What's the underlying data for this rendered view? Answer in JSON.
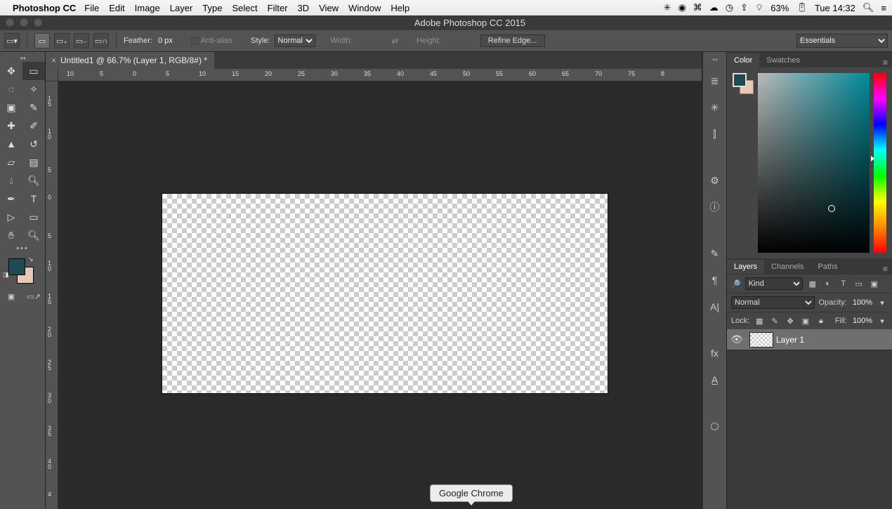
{
  "mac": {
    "app_name": "Photoshop CC",
    "menus": [
      "File",
      "Edit",
      "Image",
      "Layer",
      "Type",
      "Select",
      "Filter",
      "3D",
      "View",
      "Window",
      "Help"
    ],
    "battery_pct": "63%",
    "clock": "Tue 14:32"
  },
  "window": {
    "title": "Adobe Photoshop CC 2015"
  },
  "options": {
    "feather_label": "Feather:",
    "feather_value": "0 px",
    "antialias_label": "Anti-alias",
    "style_label": "Style:",
    "style_value": "Normal",
    "width_label": "Width:",
    "height_label": "Height:",
    "refine_label": "Refine Edge...",
    "workspace": "Essentials"
  },
  "doc": {
    "tab_title": "Untitled1 @ 66.7% (Layer 1, RGB/8#) *"
  },
  "ruler_h": [
    "10",
    "5",
    "0",
    "5",
    "10",
    "15",
    "20",
    "25",
    "30",
    "35",
    "40",
    "45",
    "50",
    "55",
    "60",
    "65",
    "70",
    "75",
    "8"
  ],
  "ruler_v": [
    {
      "a": "1",
      "b": "5"
    },
    {
      "a": "1",
      "b": "0"
    },
    {
      "a": "",
      "b": "5"
    },
    {
      "a": "0",
      "b": ""
    },
    {
      "a": "",
      "b": "5"
    },
    {
      "a": "1",
      "b": "0"
    },
    {
      "a": "1",
      "b": "5"
    },
    {
      "a": "2",
      "b": "0"
    },
    {
      "a": "2",
      "b": "5"
    },
    {
      "a": "3",
      "b": "0"
    },
    {
      "a": "3",
      "b": "5"
    },
    {
      "a": "4",
      "b": "0"
    },
    {
      "a": "4",
      "b": ""
    }
  ],
  "color_panel": {
    "tab_color": "Color",
    "tab_swatches": "Swatches"
  },
  "layers_panel": {
    "tab_layers": "Layers",
    "tab_channels": "Channels",
    "tab_paths": "Paths",
    "kind_label": "Kind",
    "blend_value": "Normal",
    "opacity_label": "Opacity:",
    "opacity_value": "100%",
    "lock_label": "Lock:",
    "fill_label": "Fill:",
    "fill_value": "100%",
    "layer1_name": "Layer 1"
  },
  "tooltip": "Google Chrome",
  "colors": {
    "fg": "#1e4b52",
    "bg": "#e8c8b4"
  }
}
